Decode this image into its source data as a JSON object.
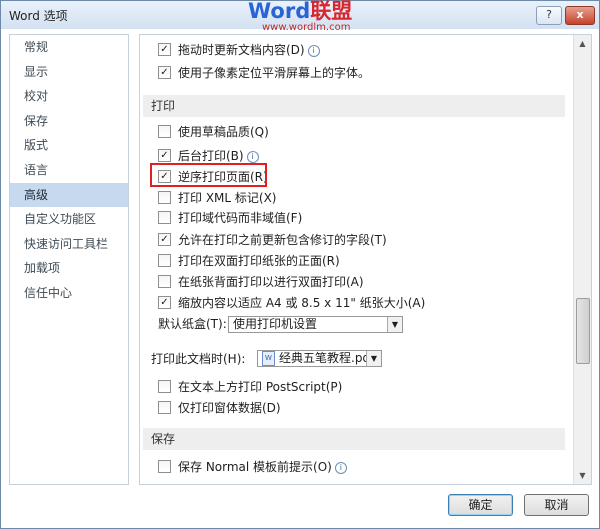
{
  "window": {
    "title": "Word 选项",
    "help_icon": "?",
    "close_icon": "x"
  },
  "watermark": {
    "brand_a": "Word",
    "brand_b": "联盟",
    "url": "www.wordlm.com"
  },
  "sidebar": {
    "items": [
      {
        "label": "常规"
      },
      {
        "label": "显示"
      },
      {
        "label": "校对"
      },
      {
        "label": "保存"
      },
      {
        "label": "版式"
      },
      {
        "label": "语言"
      },
      {
        "label": "高级",
        "selected": true
      },
      {
        "label": "自定义功能区"
      },
      {
        "label": "快速访问工具栏"
      },
      {
        "label": "加载项"
      },
      {
        "label": "信任中心"
      }
    ]
  },
  "content": {
    "top_rows": [
      {
        "label": "拖动时更新文档内容(D)",
        "checked": true,
        "info": true
      },
      {
        "label": "使用子像素定位平滑屏幕上的字体。",
        "checked": true
      }
    ],
    "print_section": "打印",
    "print_rows": [
      {
        "label": "使用草稿品质(Q)",
        "checked": false
      },
      {
        "label": "后台打印(B)",
        "checked": true,
        "info": true
      },
      {
        "label": "逆序打印页面(R)",
        "checked": true
      },
      {
        "label": "打印 XML 标记(X)",
        "checked": false
      },
      {
        "label": "打印域代码而非域值(F)",
        "checked": false
      },
      {
        "label": "允许在打印之前更新包含修订的字段(T)",
        "checked": true
      },
      {
        "label": "打印在双面打印纸张的正面(R)",
        "checked": false
      },
      {
        "label": "在纸张背面打印以进行双面打印(A)",
        "checked": false
      },
      {
        "label": "缩放内容以适应 A4 或 8.5 x 11\" 纸张大小(A)",
        "checked": true
      }
    ],
    "tray": {
      "label": "默认纸盒(T):",
      "value": "使用打印机设置"
    },
    "doc_print": {
      "label": "打印此文档时(H):",
      "value": "经典五笔教程.pdf",
      "file_icon": "W"
    },
    "doc_rows": [
      {
        "label": "在文本上方打印 PostScript(P)",
        "checked": false
      },
      {
        "label": "仅打印窗体数据(D)",
        "checked": false
      }
    ],
    "save_section": "保存",
    "save_rows": [
      {
        "label": "保存 Normal 模板前提示(O)",
        "checked": false,
        "info": true
      }
    ],
    "check_glyph": "✓",
    "info_glyph": "i"
  },
  "buttons": {
    "ok": "确定",
    "cancel": "取消"
  }
}
